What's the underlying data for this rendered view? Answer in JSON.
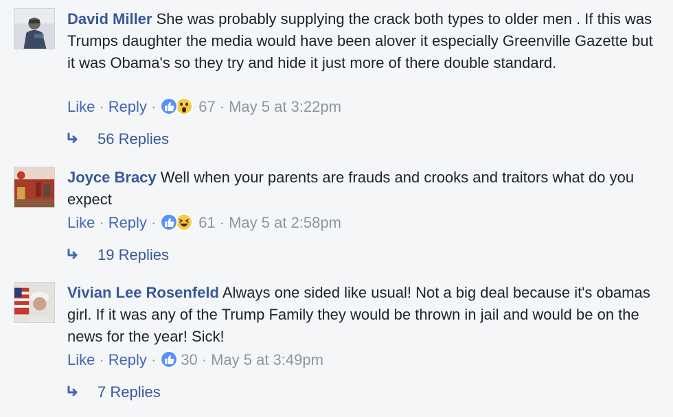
{
  "comments": [
    {
      "author": "David Miller",
      "text": "She was probably supplying the crack both types to older men . If this was Trumps daughter the media would have been alover it especially Greenville Gazette but it was Obama's so they try and hide it just more of there double standard.",
      "like_label": "Like",
      "reply_label": "Reply",
      "reactions": [
        "like-icon",
        "wow-icon"
      ],
      "reaction_count": "67",
      "timestamp": "May 5 at 3:22pm",
      "replies_label": "56 Replies"
    },
    {
      "author": "Joyce Bracy",
      "text": "Well when your parents are frauds and crooks and traitors what do you expect",
      "like_label": "Like",
      "reply_label": "Reply",
      "reactions": [
        "like-icon",
        "haha-icon"
      ],
      "reaction_count": "61",
      "timestamp": "May 5 at 2:58pm",
      "replies_label": "19 Replies"
    },
    {
      "author": "Vivian Lee Rosenfeld",
      "text": "Always one sided like usual! Not a big deal because it's obamas girl. If it was any of the Trump Family they would be thrown in jail and would be on the news for the year! Sick!",
      "like_label": "Like",
      "reply_label": "Reply",
      "reactions": [
        "like-icon"
      ],
      "reaction_count": "30",
      "timestamp": "May 5 at 3:49pm",
      "replies_label": "7 Replies"
    }
  ],
  "separator": "·",
  "colors": {
    "background": "#f5f6f8",
    "author": "#365899",
    "link": "#4267b2",
    "meta": "#90949c",
    "text": "#1d2129",
    "like_blue": "#5890ff",
    "emoji_yellow": "#f7c948"
  }
}
